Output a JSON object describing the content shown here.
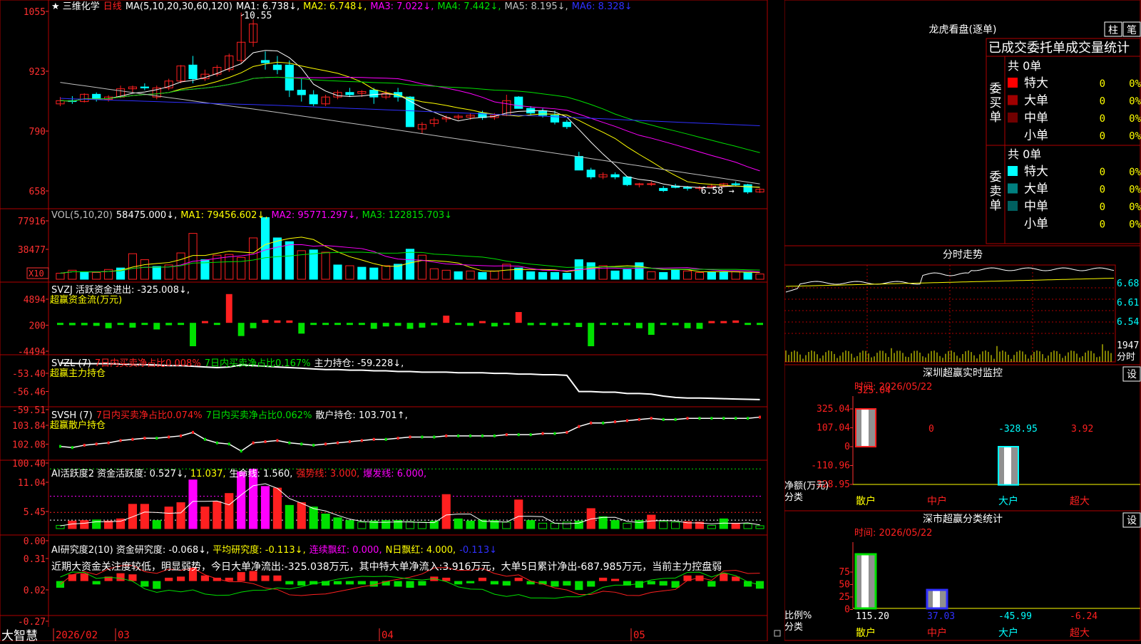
{
  "app": {
    "brand": "大智慧"
  },
  "stock": {
    "star": "★",
    "name": "三维化学",
    "period": "日线"
  },
  "colors": {
    "up": "#ff2020",
    "down": "#00ffff",
    "grid": "#b00000",
    "axis": "#ff3030",
    "white": "#ffffff",
    "yellow": "#ffff00",
    "magenta": "#ff00ff",
    "green": "#00e000",
    "blue": "#3030ff",
    "gray": "#c0c0c0",
    "cyan": "#00ffff"
  },
  "price_panel": {
    "header": {
      "params": "MA(5,10,20,30,60,120)",
      "ma1": "MA1: 6.738↓,",
      "ma2": "MA2: 6.748↓,",
      "ma3": "MA3: 7.022↓,",
      "ma4": "MA4: 7.442↓,",
      "ma5": "MA5: 8.195↓,",
      "ma6": "MA6: 8.328↓"
    },
    "yticks": [
      "1055",
      "923",
      "790",
      "658"
    ],
    "high_label": "10.55",
    "low_label": "6.58 →"
  },
  "vol_panel": {
    "header": {
      "params": "VOL(5,10,20)",
      "vol": "58475.000↓,",
      "ma1": "MA1: 79456.602↓,",
      "ma2": "MA2: 95771.297↓,",
      "ma3": "MA3: 122815.703↓"
    },
    "yticks": [
      "77916",
      "38477"
    ],
    "unit": "X10"
  },
  "svzj_panel": {
    "header": {
      "title": "SVZJ  活跃资金进出: -325.008↓,",
      "sub": "超赢资金流(万元)"
    },
    "yticks": [
      "4894",
      "200",
      "-4494"
    ]
  },
  "svzl_panel": {
    "header": {
      "a": "SVZL (7)",
      "b": "7日内买卖净占比0.008%",
      "c": "7日内买卖净占比0.167%",
      "d": "主力持仓: -59.228↓,",
      "sub": "超赢主力持仓"
    },
    "yticks": [
      "-53.40",
      "-56.46",
      "-59.51"
    ]
  },
  "svsh_panel": {
    "header": {
      "a": "SVSH (7)",
      "b": "7日内买卖净占比0.074%",
      "c": "7日内买卖净占比0.062%",
      "d": "散户持仓: 103.701↑,",
      "sub": "超赢散户持仓"
    },
    "yticks": [
      "103.84",
      "102.08",
      "100.40"
    ]
  },
  "ai_active_panel": {
    "header": {
      "a": "AI活跃度2 资金活跃度: 0.527↓,",
      "b": "11.037,",
      "c": "生命线: 1.560,",
      "d": "强势线: 3.000,",
      "e": "爆发线: 6.000,"
    },
    "yticks": [
      "11.04",
      "5.45",
      "0.00"
    ]
  },
  "ai_research_panel": {
    "header": {
      "a": "AI研究度2(10) 资金研究度: -0.068↓,",
      "b": "平均研究度: -0.113↓,",
      "c": "连续飘红: 0.000,",
      "d": "N日飘红: 4.000,",
      "e": "-0.113↓"
    },
    "comment": "近期大资金关注度较低，明显弱势，今日大单净流出:-325.038万元，其中特大单净流入:3.916万元，大单5日累计净出-687.985万元，当前主力控盘弱",
    "yticks": [
      "0.31",
      "0.02",
      "-0.27"
    ]
  },
  "xaxis": {
    "labels": [
      "2026/02",
      "03",
      "04",
      "05"
    ]
  },
  "longhu": {
    "title": "龙虎看盘(逐单)",
    "btn_bar": "柱",
    "btn_pen": "笔",
    "tabs": "已成交委托单成交量统计",
    "buy": {
      "label": [
        "委",
        "买",
        "单"
      ],
      "total": "共 0单",
      "rows": [
        {
          "name": "特大",
          "val": "0",
          "pct": "0%",
          "color": "#ff0000"
        },
        {
          "name": "大单",
          "val": "0",
          "pct": "0%",
          "color": "#a00000"
        },
        {
          "name": "中单",
          "val": "0",
          "pct": "0%",
          "color": "#700000"
        },
        {
          "name": "小单",
          "val": "0",
          "pct": "0%",
          "color": ""
        }
      ]
    },
    "sell": {
      "label": [
        "委",
        "卖",
        "单"
      ],
      "total": "共 0单",
      "rows": [
        {
          "name": "特大",
          "val": "0",
          "pct": "0%",
          "color": "#00ffff"
        },
        {
          "name": "大单",
          "val": "0",
          "pct": "0%",
          "color": "#008080"
        },
        {
          "name": "中单",
          "val": "0",
          "pct": "0%",
          "color": "#006060"
        },
        {
          "name": "小单",
          "val": "0",
          "pct": "0%",
          "color": ""
        }
      ]
    }
  },
  "intraday": {
    "title": "分时走势",
    "yticks": [
      "6.68",
      "6.61",
      "6.54"
    ],
    "vol_label": "1947",
    "unit": "分时"
  },
  "sz_monitor": {
    "title": "深圳超赢实时监控",
    "btn": "设",
    "time": "时间: 2026/05/22",
    "yticks": [
      "325.04",
      "107.04",
      "0",
      "-110.96",
      "-328.95"
    ],
    "ylabel": "净额(万元)",
    "xlabel": "分类",
    "categories": [
      "散户",
      "中户",
      "大户",
      "超大"
    ],
    "values": [
      325.04,
      0,
      -328.95,
      3.92
    ],
    "value_labels": [
      "325.04",
      "0",
      "-328.95",
      "3.92"
    ]
  },
  "sz_stats": {
    "title": "深市超赢分类统计",
    "btn": "设",
    "time": "时间: 2026/05/22",
    "yticks": [
      "75",
      "50",
      "25",
      "0"
    ],
    "ylabel": "比例%",
    "xlabel": "分类",
    "categories": [
      "散户",
      "中户",
      "大户",
      "超大"
    ],
    "values": [
      115.2,
      37.03,
      -45.99,
      -6.24
    ],
    "value_labels": [
      "115.20",
      "37.03",
      "-45.99",
      "-6.24"
    ]
  },
  "chart_data": [
    {
      "type": "candlestick",
      "title": "三维化学 日线",
      "y_display_scale": "×100 on axis",
      "ylim": [
        6.3,
        10.7
      ],
      "ohlc": [
        [
          8.55,
          8.7,
          8.5,
          8.62
        ],
        [
          8.62,
          8.72,
          8.55,
          8.6
        ],
        [
          8.6,
          8.78,
          8.58,
          8.76
        ],
        [
          8.76,
          8.8,
          8.6,
          8.65
        ],
        [
          8.65,
          8.74,
          8.6,
          8.7
        ],
        [
          8.7,
          8.95,
          8.68,
          8.88
        ],
        [
          8.88,
          8.95,
          8.8,
          8.92
        ],
        [
          8.92,
          9.0,
          8.85,
          8.9
        ],
        [
          8.7,
          8.95,
          8.65,
          8.9
        ],
        [
          8.9,
          9.1,
          8.85,
          9.05
        ],
        [
          9.05,
          9.4,
          9.0,
          9.38
        ],
        [
          9.4,
          9.6,
          9.0,
          9.1
        ],
        [
          9.1,
          9.3,
          9.05,
          9.2
        ],
        [
          9.2,
          9.4,
          9.15,
          9.35
        ],
        [
          9.3,
          9.65,
          9.25,
          9.6
        ],
        [
          9.5,
          10.55,
          9.45,
          9.9
        ],
        [
          9.9,
          10.4,
          9.8,
          10.3
        ],
        [
          9.5,
          9.7,
          9.3,
          9.45
        ],
        [
          9.4,
          9.6,
          9.2,
          9.3
        ],
        [
          9.4,
          9.5,
          8.7,
          8.85
        ],
        [
          8.85,
          9.1,
          8.6,
          8.75
        ],
        [
          8.75,
          8.85,
          8.5,
          8.55
        ],
        [
          8.55,
          8.75,
          8.5,
          8.7
        ],
        [
          8.7,
          8.85,
          8.65,
          8.8
        ],
        [
          8.8,
          8.9,
          8.7,
          8.75
        ],
        [
          8.78,
          8.85,
          8.7,
          8.82
        ],
        [
          8.85,
          8.9,
          8.55,
          8.7
        ],
        [
          8.7,
          8.85,
          8.65,
          8.78
        ],
        [
          8.8,
          8.9,
          8.6,
          8.7
        ],
        [
          8.7,
          8.72,
          8.05,
          8.05
        ],
        [
          8.0,
          8.15,
          7.9,
          8.1
        ],
        [
          8.12,
          8.25,
          8.05,
          8.2
        ],
        [
          8.22,
          8.3,
          8.15,
          8.25
        ],
        [
          8.25,
          8.32,
          8.2,
          8.28
        ],
        [
          8.26,
          8.35,
          8.2,
          8.3
        ],
        [
          8.35,
          8.4,
          8.2,
          8.25
        ],
        [
          8.25,
          8.35,
          8.2,
          8.3
        ],
        [
          8.3,
          8.75,
          8.28,
          8.62
        ],
        [
          8.7,
          8.72,
          8.45,
          8.45
        ],
        [
          8.45,
          8.5,
          8.3,
          8.35
        ],
        [
          8.4,
          8.45,
          8.25,
          8.3
        ],
        [
          8.3,
          8.4,
          8.1,
          8.15
        ],
        [
          8.15,
          8.2,
          8.0,
          8.05
        ],
        [
          7.4,
          7.5,
          7.1,
          7.1
        ],
        [
          7.1,
          7.15,
          6.9,
          6.95
        ],
        [
          6.95,
          7.05,
          6.9,
          7.0
        ],
        [
          7.0,
          7.05,
          6.9,
          6.95
        ],
        [
          6.95,
          6.95,
          6.75,
          6.78
        ],
        [
          6.78,
          6.82,
          6.72,
          6.8
        ],
        [
          6.8,
          6.85,
          6.75,
          6.8
        ],
        [
          6.7,
          6.75,
          6.62,
          6.65
        ],
        [
          6.75,
          6.8,
          6.7,
          6.72
        ],
        [
          6.72,
          6.75,
          6.65,
          6.7
        ],
        [
          6.7,
          6.75,
          6.65,
          6.72
        ],
        [
          6.72,
          6.8,
          6.7,
          6.75
        ],
        [
          6.75,
          6.82,
          6.72,
          6.8
        ],
        [
          6.8,
          6.85,
          6.75,
          6.78
        ],
        [
          6.78,
          6.8,
          6.58,
          6.62
        ],
        [
          6.62,
          6.7,
          6.6,
          6.68
        ]
      ]
    },
    {
      "type": "bar",
      "title": "VOL",
      "ylim": [
        0,
        9000
      ],
      "values": [
        800,
        1200,
        1000,
        900,
        1300,
        1500,
        3400,
        2600,
        1700,
        1900,
        3500,
        6100,
        2600,
        3200,
        3300,
        2900,
        5500,
        8200,
        5500,
        5000,
        3800,
        3900,
        3600,
        1900,
        1800,
        1600,
        1500,
        1800,
        2000,
        4000,
        3200,
        1400,
        1200,
        1000,
        1100,
        900,
        1100,
        2000,
        1500,
        1000,
        900,
        900,
        800,
        2600,
        2200,
        1800,
        1100,
        1300,
        2200,
        1000,
        900,
        1200,
        1100,
        900,
        900,
        1000,
        1000,
        900,
        700
      ],
      "up": [
        true,
        true,
        false,
        true,
        true,
        false,
        true,
        true,
        false,
        true,
        true,
        true,
        false,
        true,
        true,
        true,
        true,
        false,
        false,
        false,
        true,
        false,
        true,
        false,
        true,
        false,
        false,
        true,
        false,
        false,
        true,
        true,
        true,
        false,
        true,
        false,
        true,
        true,
        false,
        false,
        false,
        false,
        false,
        false,
        false,
        true,
        false,
        false,
        false,
        true,
        false,
        false,
        true,
        true,
        false,
        false,
        true,
        false,
        true
      ]
    },
    {
      "type": "bar",
      "title": "SVZJ 活跃资金进出",
      "ylim": [
        -4494,
        4894
      ],
      "values": [
        -300,
        -400,
        -400,
        -500,
        -900,
        -300,
        -800,
        -200,
        -1100,
        -400,
        -300,
        -3900,
        300,
        -300,
        4800,
        -2200,
        -900,
        500,
        400,
        400,
        -1800,
        -200,
        -200,
        -300,
        -100,
        -300,
        -1000,
        -600,
        -500,
        -1000,
        -800,
        -400,
        1200,
        -300,
        -500,
        300,
        -600,
        -300,
        1800,
        -400,
        -300,
        -500,
        -300,
        -700,
        -3900,
        -300,
        -200,
        -400,
        -900,
        -2000,
        -200,
        -400,
        -900,
        -1000,
        300,
        300,
        400,
        -300,
        -325
      ]
    },
    {
      "type": "line",
      "title": "SVZL 主力持仓",
      "ylim": [
        -59.8,
        -53.2
      ],
      "values": [
        -53.6,
        -53.65,
        -53.7,
        -53.7,
        -53.7,
        -53.75,
        -53.8,
        -53.85,
        -53.9,
        -54.0,
        -54.0,
        -54.1,
        -54.2,
        -54.3,
        -54.2,
        -53.9,
        -54.0,
        -54.1,
        -54.2,
        -54.3,
        -54.4,
        -54.5,
        -54.6,
        -54.6,
        -54.7,
        -54.7,
        -54.8,
        -54.8,
        -54.9,
        -54.9,
        -55.0,
        -55.0,
        -55.0,
        -55.1,
        -55.1,
        -55.1,
        -55.2,
        -55.2,
        -55.3,
        -55.3,
        -55.4,
        -55.4,
        -55.5,
        -58.0,
        -58.0,
        -58.1,
        -58.1,
        -58.3,
        -58.3,
        -58.4,
        -58.7,
        -58.9,
        -59.0,
        -59.0,
        -59.05,
        -59.1,
        -59.15,
        -59.2,
        -59.23
      ]
    },
    {
      "type": "line",
      "title": "SVSH 散户持仓",
      "ylim": [
        100.2,
        104.1
      ],
      "values": [
        101.2,
        101.1,
        101.3,
        101.4,
        101.5,
        101.7,
        101.8,
        101.9,
        101.9,
        102.0,
        102.1,
        102.4,
        101.8,
        101.5,
        101.4,
        100.8,
        101.5,
        101.6,
        101.7,
        101.5,
        101.4,
        101.3,
        101.4,
        101.5,
        101.6,
        101.7,
        101.8,
        101.8,
        101.9,
        102.0,
        102.0,
        102.0,
        102.1,
        102.1,
        102.1,
        102.1,
        102.1,
        102.2,
        102.2,
        102.2,
        102.3,
        102.3,
        102.4,
        102.9,
        103.2,
        103.2,
        103.3,
        103.4,
        103.5,
        103.6,
        103.5,
        103.5,
        103.6,
        103.6,
        103.6,
        103.6,
        103.6,
        103.6,
        103.7
      ]
    },
    {
      "type": "bar",
      "title": "AI活跃度2 资金活跃度",
      "ylim": [
        0,
        11.6
      ],
      "values": [
        0.6,
        1.4,
        1.5,
        1.6,
        1.4,
        1.8,
        4.5,
        4.5,
        1.5,
        4.0,
        4.8,
        9.0,
        4.0,
        5.0,
        6.5,
        10.5,
        11.0,
        7.8,
        7.5,
        4.3,
        4.8,
        4.0,
        2.7,
        2.0,
        1.5,
        1.2,
        1.4,
        1.5,
        1.5,
        1.3,
        1.2,
        1.4,
        6.3,
        1.8,
        1.4,
        1.6,
        1.5,
        1.2,
        5.3,
        1.5,
        1.0,
        1.0,
        1.2,
        1.4,
        3.7,
        2.2,
        1.5,
        1.0,
        1.5,
        2.5,
        1.3,
        1.2,
        1.3,
        1.2,
        0.6,
        1.8,
        1.0,
        0.9,
        0.53
      ],
      "up": [
        false,
        true,
        true,
        false,
        true,
        true,
        true,
        true,
        false,
        true,
        true,
        true,
        true,
        true,
        true,
        true,
        true,
        true,
        true,
        false,
        true,
        false,
        false,
        false,
        false,
        false,
        false,
        false,
        false,
        false,
        false,
        false,
        true,
        false,
        false,
        false,
        false,
        false,
        true,
        false,
        false,
        false,
        false,
        false,
        true,
        false,
        false,
        false,
        false,
        true,
        false,
        false,
        true,
        true,
        false,
        false,
        true,
        false,
        false
      ]
    },
    {
      "type": "bar",
      "title": "AI研究度2(10) 资金研究度",
      "ylim": [
        -0.27,
        0.31
      ],
      "values": [
        -0.06,
        0.06,
        0.07,
        -0.03,
        0.04,
        0.07,
        0.06,
        -0.05,
        -0.07,
        0.03,
        0.04,
        0.12,
        0.05,
        0.03,
        0.03,
        0.08,
        0.09,
        0.05,
        0.05,
        -0.03,
        -0.04,
        -0.03,
        -0.04,
        -0.03,
        -0.03,
        -0.03,
        -0.05,
        -0.04,
        -0.05,
        -0.06,
        -0.04,
        0.04,
        0.03,
        -0.03,
        -0.02,
        0.03,
        -0.03,
        -0.04,
        0.03,
        -0.03,
        -0.03,
        -0.05,
        -0.04,
        -0.08,
        -0.05,
        0.03,
        0.02,
        -0.04,
        -0.06,
        -0.03,
        -0.04,
        -0.06,
        0.05,
        0.05,
        -0.05,
        0.07,
        0.04,
        -0.05,
        -0.068
      ]
    }
  ]
}
